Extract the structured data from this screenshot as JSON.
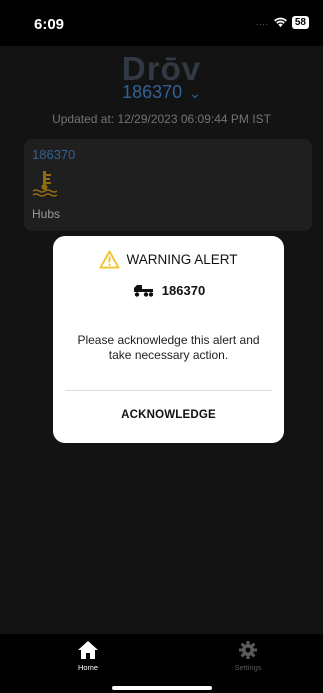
{
  "status_bar": {
    "time": "6:09",
    "signal": "....",
    "battery": "58"
  },
  "header": {
    "logo_text": "Drōv",
    "vehicle": "186370",
    "updated_text": "Updated at: 12/29/2023 06:09:44 PM IST"
  },
  "card": {
    "title": "186370",
    "label": "Hubs",
    "icon": "coolant-temperature-icon"
  },
  "modal": {
    "title": "WARNING ALERT",
    "vehicle": "186370",
    "message": "Please acknowledge this alert and take necessary action.",
    "ack_label": "ACKNOWLEDGE"
  },
  "tabbar": {
    "home_label": "Home",
    "settings_label": "Settings"
  },
  "colors": {
    "accent": "#4a90d9",
    "warning": "#f2c230",
    "coolant_icon": "#d4a017"
  }
}
